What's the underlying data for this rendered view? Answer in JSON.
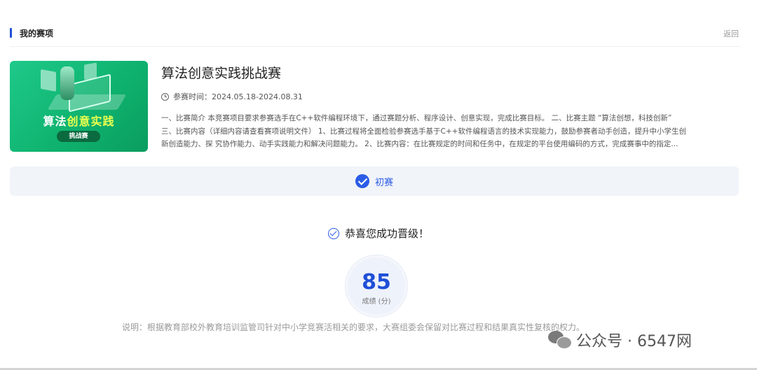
{
  "header": {
    "title": "我的赛项",
    "back_label": "返回"
  },
  "cover": {
    "title_part1": "算法",
    "title_part2": "创意实践",
    "badge": "挑战赛"
  },
  "competition": {
    "title": "算法创意实践挑战赛",
    "time_label": "参赛时间：2024.05.18-2024.08.31",
    "description_lines": [
      "一、比赛简介 本竞赛项目要求参赛选手在C++软件编程环境下，通过赛题分析、程序设计、创意实现，完成比赛目标。 二、比赛主题 “算法创想，科技创新”",
      "三、比赛内容（详细内容请查看赛项说明文件） 1、比赛过程将全面检验参赛选手基于C++软件编程语言的技术实现能力，鼓励参赛者动手创造，提升中小学生创",
      "新创造能力、探 究协作能力、动手实践能力和解决问题能力。 2、比赛内容：在比赛规定的时间和任务中，在规定的平台使用编码的方式，完成赛事中的指定..."
    ]
  },
  "stage": {
    "label": "初赛",
    "icon": "check-circle-icon"
  },
  "result": {
    "congrats": "恭喜您成功晋级！",
    "score": "85",
    "score_label": "成绩 (分)"
  },
  "note": "说明：根据教育部校外教育培训监管司针对中小学竞赛活相关的要求，大赛组委会保留对比赛过程和结果真实性复核的权力。",
  "watermark": {
    "text": "公众号 · 6547网",
    "icon": "wechat-icon"
  },
  "colors": {
    "accent": "#2b5ce6",
    "score": "#1f4fd8",
    "cover_green": "#1fc98a"
  }
}
